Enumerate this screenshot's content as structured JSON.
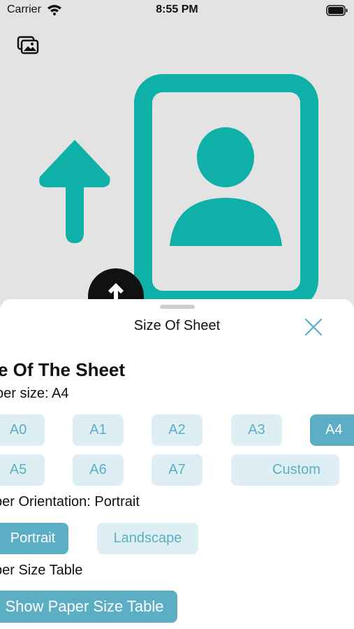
{
  "status_bar": {
    "carrier": "Carrier",
    "time": "8:55 PM"
  },
  "colors": {
    "accent": "#5BAEC4",
    "accent_light": "#DEEFF4",
    "illustration": "#0FB0A8",
    "preview_background": "#E3E3E3"
  },
  "icons": {
    "gallery": "photo-gallery-icon",
    "upload": "arrow-up-icon",
    "close": "close-x-icon",
    "wifi": "wifi-icon",
    "battery": "battery-icon"
  },
  "sheet": {
    "title": "Size Of Sheet",
    "section_heading": "ze Of The Sheet",
    "paper_size_line": "per size: A4",
    "paper_sizes": [
      "A0",
      "A1",
      "A2",
      "A3",
      "A4",
      "A5",
      "A6",
      "A7",
      "Custom"
    ],
    "selected_paper_size": "A4",
    "orientation_line": "per Orientation: Portrait",
    "orientations": [
      "Portrait",
      "Landscape"
    ],
    "selected_orientation": "Portrait",
    "table_line": "per Size Table",
    "show_table_button": "Show Paper Size Table"
  }
}
